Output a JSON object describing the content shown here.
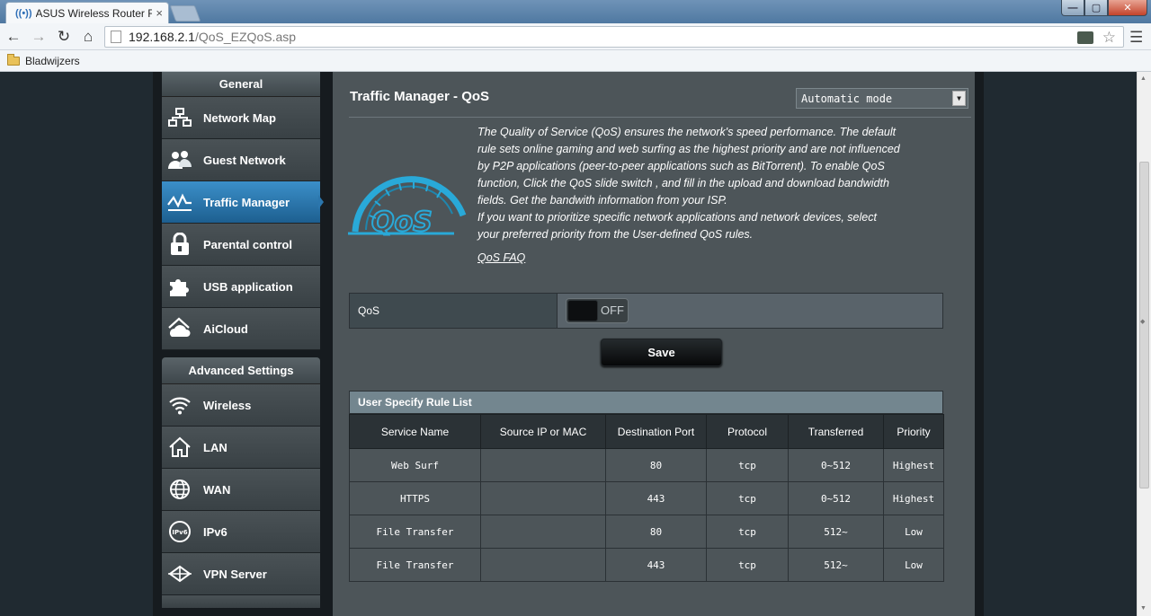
{
  "browser": {
    "tab_title": "ASUS Wireless Router RT-N",
    "tab_close": "×",
    "address_host": "192.168.2.1",
    "address_path": "/QoS_EZQoS.asp",
    "bookmarks_label": "Bladwijzers"
  },
  "sidebar": {
    "general_heading": "General",
    "general_items": [
      {
        "label": "Network Map",
        "icon": "network-map-icon"
      },
      {
        "label": "Guest Network",
        "icon": "guest-network-icon"
      },
      {
        "label": "Traffic Manager",
        "icon": "traffic-manager-icon",
        "active": true
      },
      {
        "label": "Parental control",
        "icon": "lock-icon"
      },
      {
        "label": "USB application",
        "icon": "puzzle-icon"
      },
      {
        "label": "AiCloud",
        "icon": "cloud-icon"
      }
    ],
    "advanced_heading": "Advanced Settings",
    "advanced_items": [
      {
        "label": "Wireless",
        "icon": "wifi-icon"
      },
      {
        "label": "LAN",
        "icon": "home-icon"
      },
      {
        "label": "WAN",
        "icon": "globe-icon"
      },
      {
        "label": "IPv6",
        "icon": "ipv6-icon"
      },
      {
        "label": "VPN Server",
        "icon": "vpn-icon"
      }
    ]
  },
  "content": {
    "title": "Traffic Manager - QoS",
    "mode_selected": "Automatic mode",
    "logo_text": "QoS",
    "description": "The Quality of Service (QoS) ensures the network's speed performance. The default rule sets online gaming and web surfing as the highest priority and are not influenced by P2P applications (peer-to-peer applications such as BitTorrent). To enable QoS function, Click the QoS slide switch , and fill in the upload and download bandwidth fields. Get the bandwith information from your ISP.",
    "description2": "If you want to prioritize specific network applications and network devices, select your preferred priority from the User-defined QoS rules.",
    "faq_link": "QoS FAQ",
    "qos_label": "QoS",
    "qos_state": "OFF",
    "save_label": "Save"
  },
  "rule_list": {
    "caption": "User Specify Rule List",
    "columns": [
      "Service Name",
      "Source IP or MAC",
      "Destination Port",
      "Protocol",
      "Transferred",
      "Priority"
    ],
    "rows": [
      [
        "Web Surf",
        "",
        "80",
        "tcp",
        "0~512",
        "Highest"
      ],
      [
        "HTTPS",
        "",
        "443",
        "tcp",
        "0~512",
        "Highest"
      ],
      [
        "File Transfer",
        "",
        "80",
        "tcp",
        "512~",
        "Low"
      ],
      [
        "File Transfer",
        "",
        "443",
        "tcp",
        "512~",
        "Low"
      ]
    ]
  },
  "colors": {
    "accent_blue": "#2b76ad",
    "content_bg": "#4d5559",
    "sidebar_bg": "#394145"
  }
}
